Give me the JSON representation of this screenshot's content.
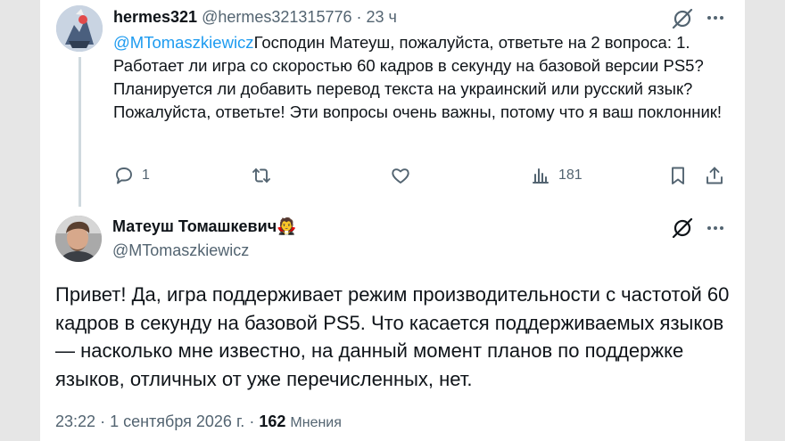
{
  "reply_tweet": {
    "author_name": "hermes321",
    "author_handle": "@hermes321315776",
    "separator": "·",
    "time_ago": "23 ч",
    "mention": "@MTomaszkiewicz",
    "text": "Господин Матеуш, пожалуйста, ответьте на 2 вопроса: 1. Работает ли игра со скоростью 60 кадров в секунду на базовой версии PS5? Планируется ли добавить перевод текста на украинский или русский язык? Пожалуйста, ответьте! Эти вопросы очень важны, потому что я ваш поклонник!",
    "reply_count": "1",
    "view_count": "181"
  },
  "main_tweet": {
    "author_name": "Матеуш Томашкевич",
    "name_emoji": "🧛",
    "author_handle": "@MTomaszkiewicz",
    "text": "Привет! Да, игра поддерживает режим производительности с частотой 60 кадров в секунду на базовой PS5. Что касается поддерживаемых языков — насколько мне известно, на данный момент планов по поддержке языков, отличных от уже перечисленных, нет.",
    "time": "23:22",
    "separator": "·",
    "date": "1 сентября 2026 г.",
    "separator2": "·",
    "views_count": "162",
    "views_label": "Мнения"
  },
  "icons": [
    "grok-icon",
    "more-icon",
    "reply-icon",
    "retweet-icon",
    "like-icon",
    "views-icon",
    "bookmark-icon",
    "share-icon"
  ],
  "colors": {
    "link": "#1d9bf0",
    "text": "#0f1419",
    "muted": "#536471",
    "background": "#ffffff"
  }
}
